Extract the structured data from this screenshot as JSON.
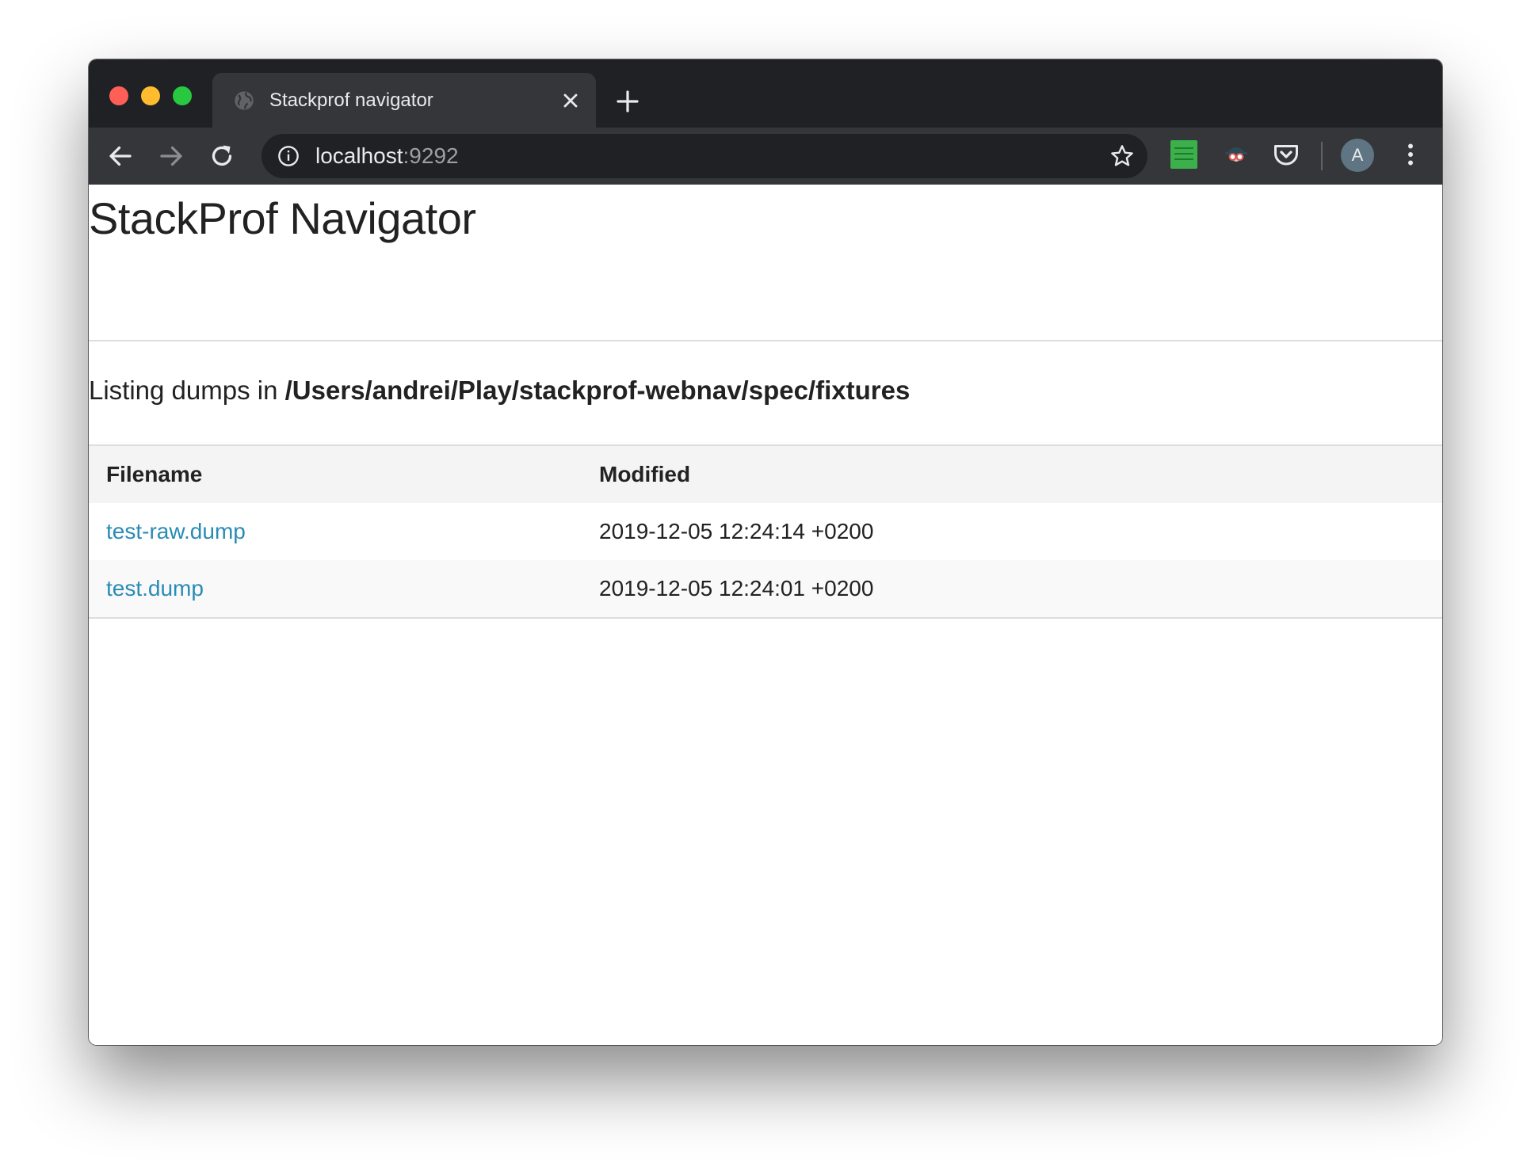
{
  "browser": {
    "tab_title": "Stackprof navigator",
    "url_host": "localhost",
    "url_port": ":9292",
    "avatar_initial": "A"
  },
  "page": {
    "title": "StackProf Navigator",
    "listing_prefix": "Listing dumps in ",
    "listing_path": "/Users/andrei/Play/stackprof-webnav/spec/fixtures"
  },
  "table": {
    "headers": [
      "Filename",
      "Modified"
    ],
    "rows": [
      {
        "filename": "test-raw.dump",
        "modified": "2019-12-05 12:24:14 +0200"
      },
      {
        "filename": "test.dump",
        "modified": "2019-12-05 12:24:01 +0200"
      }
    ]
  },
  "colors": {
    "link": "#2a8bb5",
    "chrome_dark": "#202124",
    "chrome_toolbar": "#35363a"
  },
  "icons": {
    "tab_favicon": "globe-icon",
    "tab_close": "close-icon",
    "new_tab": "plus-icon",
    "back": "arrow-left-icon",
    "forward": "arrow-right-icon",
    "reload": "reload-icon",
    "site_info": "info-icon",
    "bookmark": "star-icon",
    "extensions": [
      "sheets-extension-icon",
      "spy-extension-icon",
      "pocket-icon"
    ],
    "menu": "kebab-menu-icon"
  }
}
